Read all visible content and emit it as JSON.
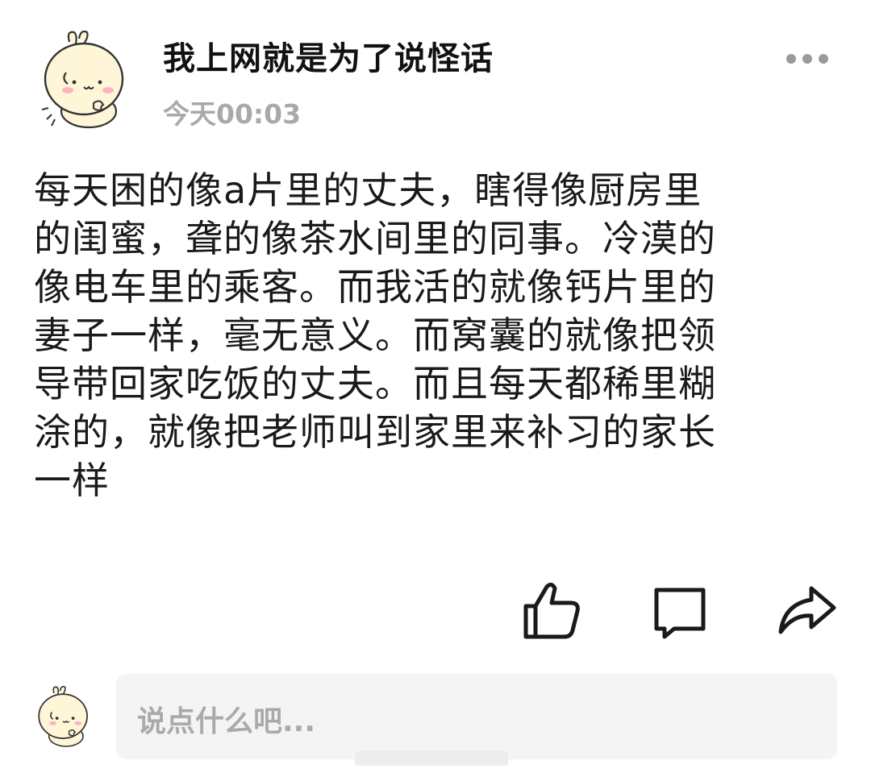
{
  "post": {
    "author": "我上网就是为了说怪话",
    "time": "今天00:03",
    "content_lines": [
      "每天困的像a片里的丈夫，瞎得像厨房里",
      "的闺蜜，聋的像茶水间里的同事。冷漠的",
      "像电车里的乘客。而我活的就像钙片里的",
      "妻子一样，毫无意义。而窝囊的就像把领",
      "导带回家吃饭的丈夫。而且每天都稀里糊",
      "涂的，就像把老师叫到家里来补习的家长",
      "一样"
    ]
  },
  "icons": {
    "more": "more-dots-icon",
    "like": "thumbs-up-icon",
    "comment": "comment-bubble-icon",
    "share": "share-arrow-icon"
  },
  "comment_input": {
    "placeholder": "说点什么吧..."
  },
  "colors": {
    "text": "#1a1a1a",
    "muted": "#a9a9a9",
    "input_bg": "#f4f4f4",
    "avatar_face": "#fff6d8"
  }
}
